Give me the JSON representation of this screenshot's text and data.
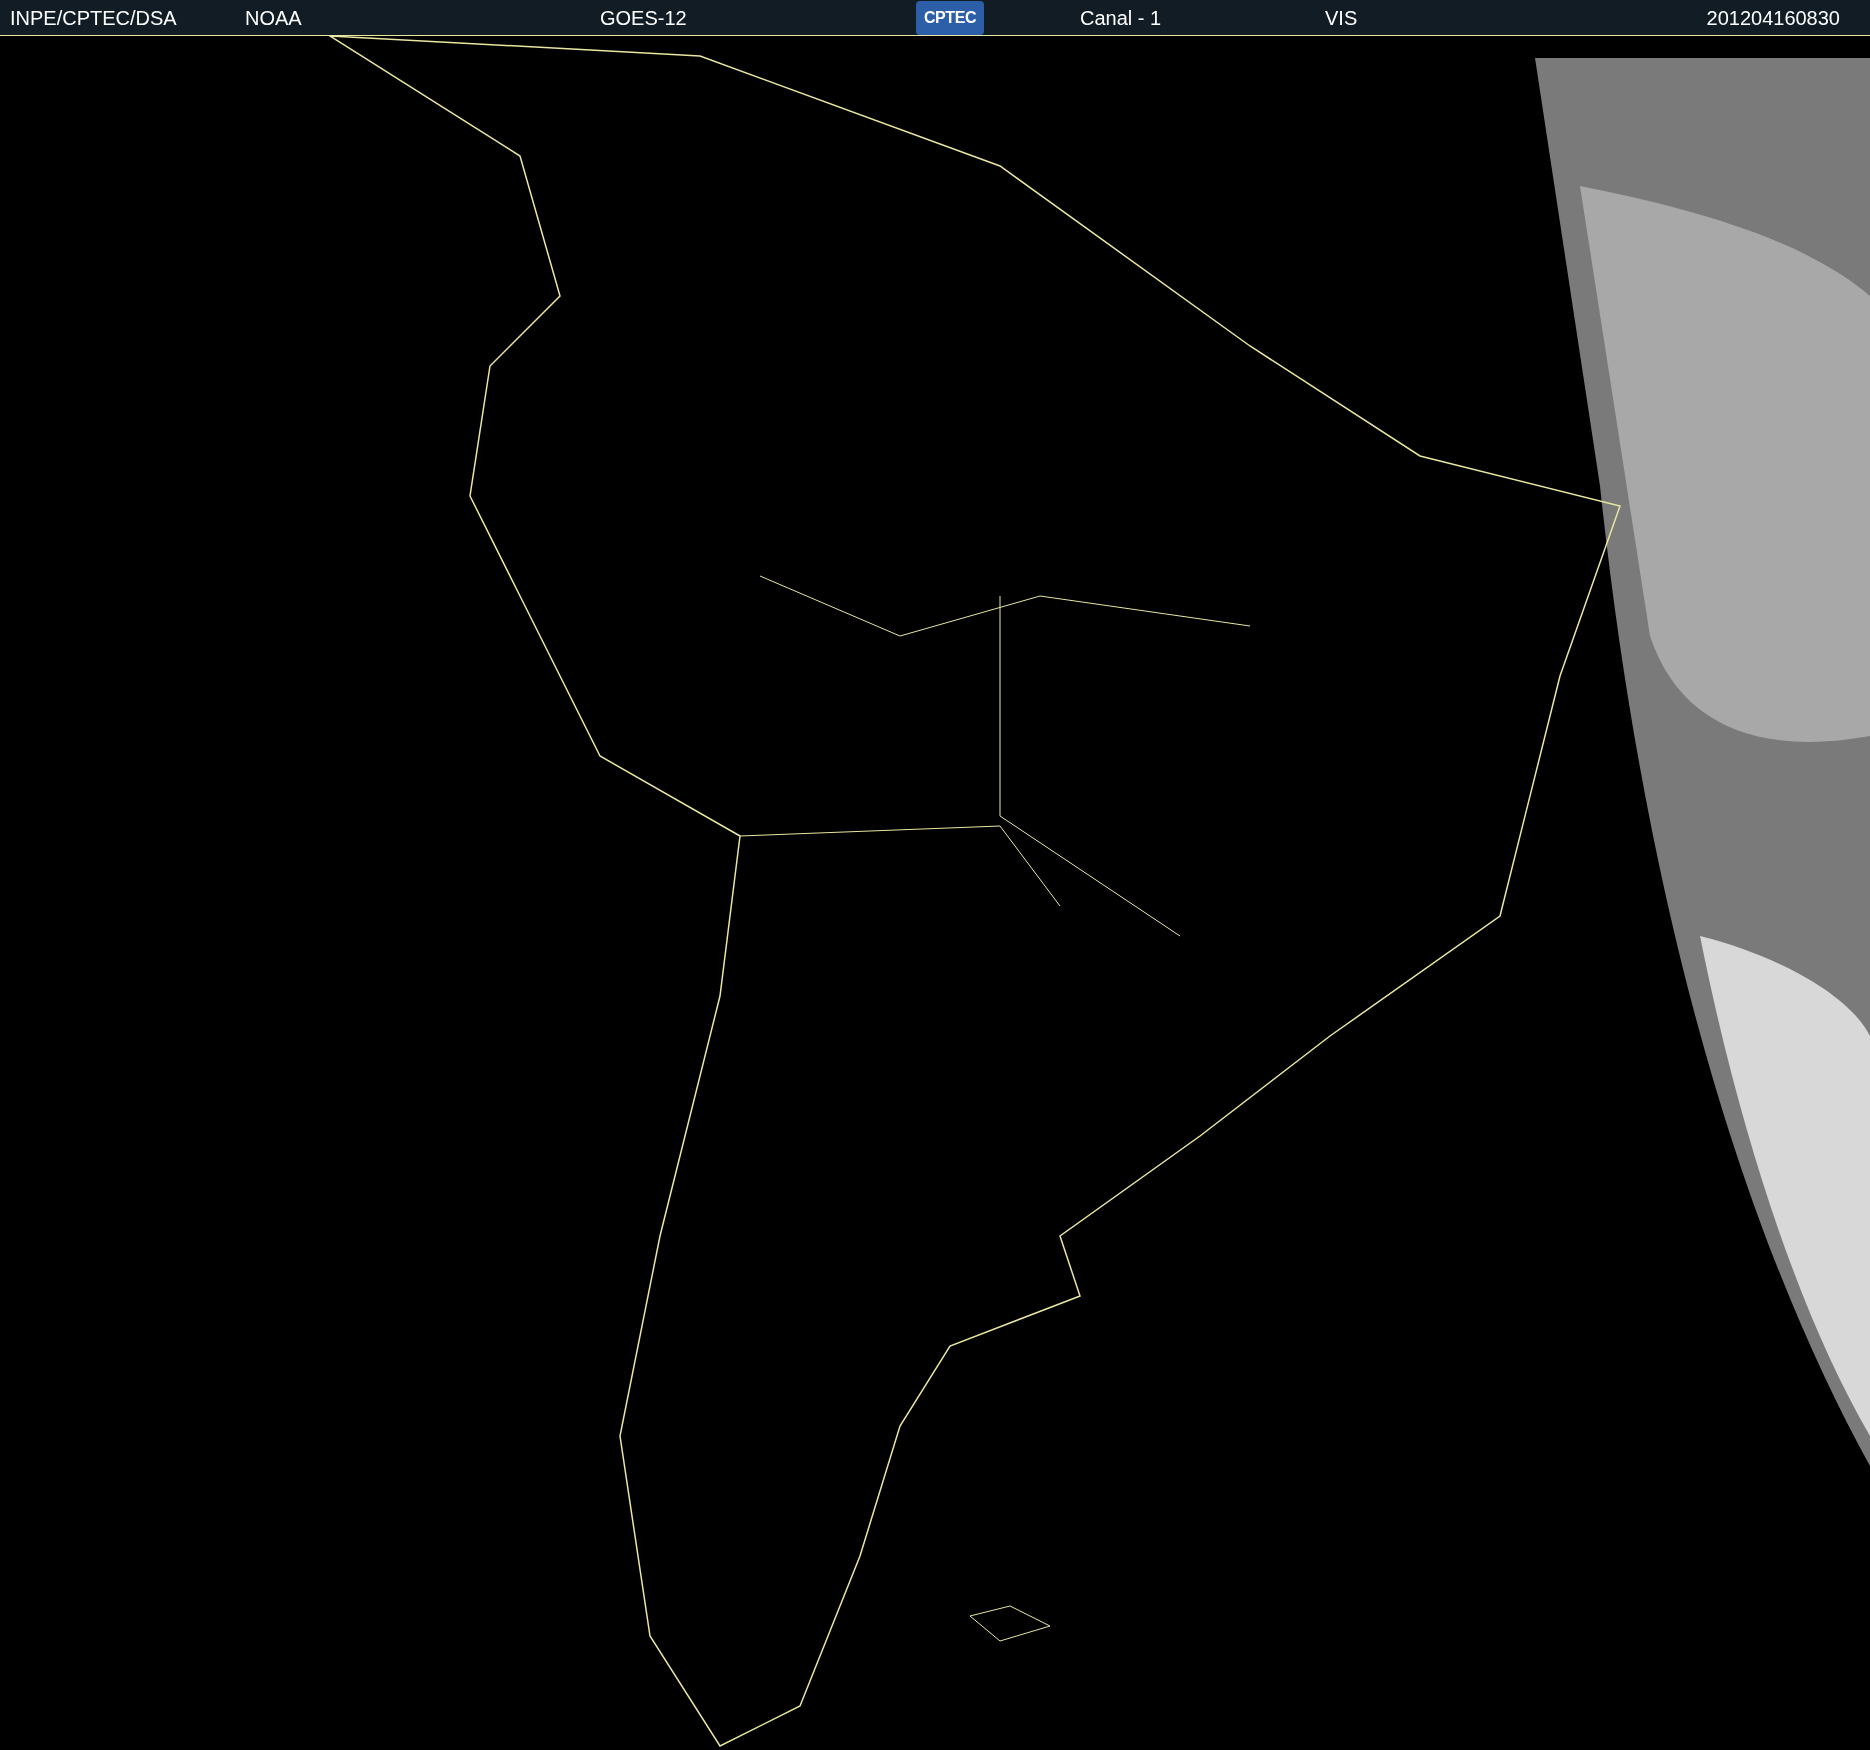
{
  "header": {
    "source": "INPE/CPTEC/DSA",
    "agency": "NOAA",
    "satellite": "GOES-12",
    "logo_text": "CPTEC",
    "channel": "Canal - 1",
    "band": "VIS",
    "timestamp": "201204160830"
  }
}
